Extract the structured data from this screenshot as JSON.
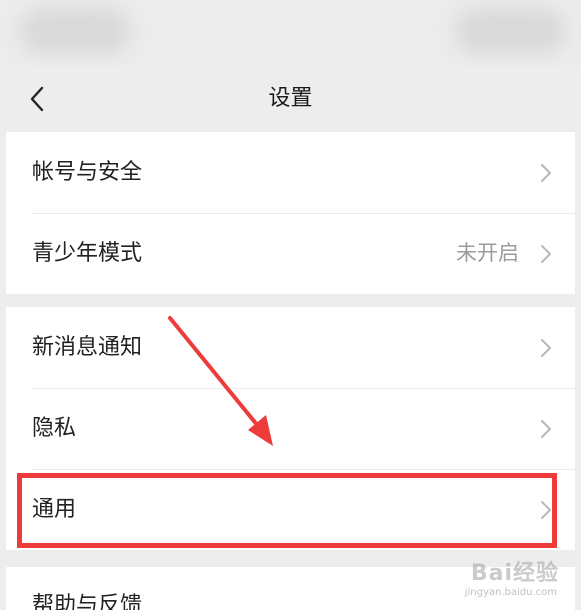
{
  "nav": {
    "title": "设置",
    "back_icon": "chevron-left-icon"
  },
  "groups": [
    {
      "items": [
        {
          "label": "帐号与安全",
          "value": "",
          "icon": "chevron-right-icon"
        },
        {
          "label": "青少年模式",
          "value": "未开启",
          "icon": "chevron-right-icon"
        }
      ]
    },
    {
      "items": [
        {
          "label": "新消息通知",
          "value": "",
          "icon": "chevron-right-icon"
        },
        {
          "label": "隐私",
          "value": "",
          "icon": "chevron-right-icon"
        },
        {
          "label": "通用",
          "value": "",
          "icon": "chevron-right-icon",
          "highlighted": true
        }
      ]
    }
  ],
  "next_item": {
    "label": "帮助与反馈"
  },
  "annotation": {
    "color": "#ee3b3b",
    "target": "通用"
  },
  "watermark": {
    "text": "Bai经验",
    "sub": "jingyan.baidu.com"
  },
  "colors": {
    "background": "#ededed",
    "row": "#ffffff",
    "label": "#222222",
    "value": "#9b9b9b",
    "chevron": "#b8b8b8"
  }
}
